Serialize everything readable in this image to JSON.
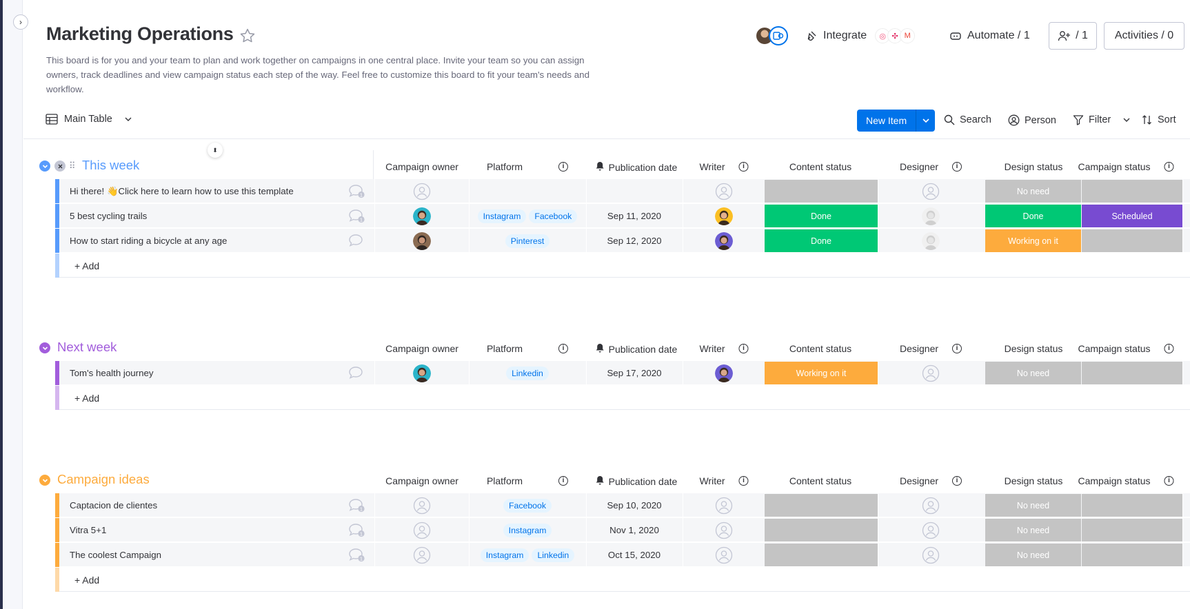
{
  "board": {
    "title": "Marketing Operations",
    "description": "This board is for you and your team to plan and work together on campaigns in one central place. Invite your team so you can assign owners, track deadlines and view campaign status each step of the way. Feel free to customize this board to fit your team's needs and workflow."
  },
  "header": {
    "integrate_label": "Integrate",
    "automate_label": "Automate / 1",
    "members_label": "/ 1",
    "activities_label": "Activities / 0"
  },
  "toolbar": {
    "view_label": "Main Table",
    "new_item_label": "New Item",
    "search_label": "Search",
    "person_label": "Person",
    "filter_label": "Filter",
    "sort_label": "Sort"
  },
  "columns": {
    "owner": "Campaign owner",
    "platform": "Platform",
    "publication_date": "Publication date",
    "writer": "Writer",
    "content_status": "Content status",
    "designer": "Designer",
    "design_status": "Design status",
    "campaign_status": "Campaign status"
  },
  "add_label": "+ Add",
  "colors": {
    "done": "#00c875",
    "working": "#fdab3d",
    "scheduled": "#784bd1",
    "no_need": "#c4c4c4",
    "empty": "#c4c4c4",
    "group_this_week": "#579bfc",
    "group_next_week": "#a25ddc",
    "group_ideas": "#fdab3d",
    "primary": "#0073ea"
  },
  "groups": [
    {
      "title": "This week",
      "rows": [
        {
          "name": "Hi there! 👋Click here to learn how to use this template",
          "platforms": [],
          "date": "",
          "content_status": "",
          "design_status": "No need",
          "campaign_status": ""
        },
        {
          "name": "5 best cycling trails",
          "platforms": [
            "Instagram",
            "Facebook"
          ],
          "date": "Sep 11, 2020",
          "content_status": "Done",
          "design_status": "Done",
          "campaign_status": "Scheduled"
        },
        {
          "name": "How to start riding a bicycle at any age",
          "platforms": [
            "Pinterest"
          ],
          "date": "Sep 12, 2020",
          "content_status": "Done",
          "design_status": "Working on it",
          "campaign_status": ""
        }
      ]
    },
    {
      "title": "Next week",
      "rows": [
        {
          "name": "Tom's health journey",
          "platforms": [
            "Linkedin"
          ],
          "date": "Sep 17, 2020",
          "content_status": "Working on it",
          "design_status": "No need",
          "campaign_status": ""
        }
      ]
    },
    {
      "title": "Campaign ideas",
      "rows": [
        {
          "name": "Captacion de clientes",
          "platforms": [
            "Facebook"
          ],
          "date": "Sep 10, 2020",
          "content_status": "",
          "design_status": "No need",
          "campaign_status": ""
        },
        {
          "name": "Vitra 5+1",
          "platforms": [
            "Instagram"
          ],
          "date": "Nov 1, 2020",
          "content_status": "",
          "design_status": "No need",
          "campaign_status": ""
        },
        {
          "name": "The coolest Campaign",
          "platforms": [
            "Instagram",
            "Linkedin"
          ],
          "date": "Oct 15, 2020",
          "content_status": "",
          "design_status": "No need",
          "campaign_status": ""
        }
      ]
    }
  ]
}
